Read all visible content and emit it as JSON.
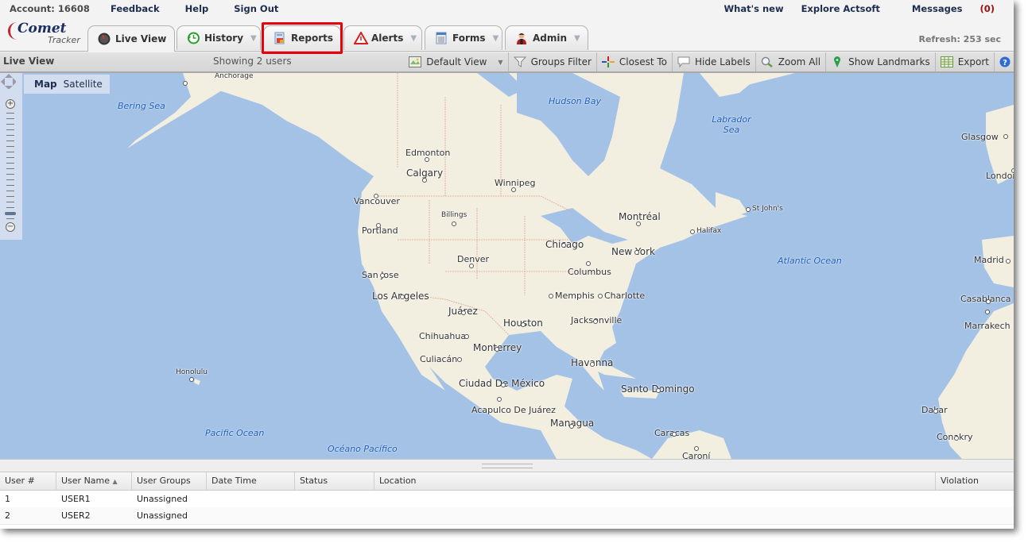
{
  "header": {
    "account_label": "Account: 16608",
    "links": [
      "Feedback",
      "Help",
      "Sign Out"
    ],
    "right_links": [
      "What's new",
      "Explore Actsoft"
    ],
    "messages_label": "Messages",
    "messages_count": "(0)",
    "refresh": "Refresh: 253 sec"
  },
  "logo": {
    "brand": "Comet",
    "sub": "Tracker"
  },
  "tabs": [
    {
      "label": "Live View",
      "icon": "speedometer-icon",
      "active": true,
      "dropdown": false
    },
    {
      "label": "History",
      "icon": "clock-icon",
      "active": false,
      "dropdown": true
    },
    {
      "label": "Reports",
      "icon": "report-icon",
      "active": false,
      "dropdown": false,
      "highlighted": true
    },
    {
      "label": "Alerts",
      "icon": "warning-icon",
      "active": false,
      "dropdown": true
    },
    {
      "label": "Forms",
      "icon": "document-icon",
      "active": false,
      "dropdown": true
    },
    {
      "label": "Admin",
      "icon": "user-icon",
      "active": false,
      "dropdown": true
    }
  ],
  "toolbar": {
    "title": "Live View",
    "showing": "Showing 2 users",
    "buttons": [
      {
        "label": "Default View",
        "icon": "map-view-icon",
        "dropdown": true
      },
      {
        "label": "Groups Filter",
        "icon": "funnel-icon"
      },
      {
        "label": "Closest To",
        "icon": "crosshair-icon"
      },
      {
        "label": "Hide Labels",
        "icon": "speech-bubble-icon"
      },
      {
        "label": "Zoom All",
        "icon": "magnifier-icon"
      },
      {
        "label": "Show Landmarks",
        "icon": "map-pin-icon"
      },
      {
        "label": "Export",
        "icon": "spreadsheet-icon"
      },
      {
        "label": "",
        "icon": "help-icon"
      }
    ]
  },
  "map": {
    "type_options": [
      "Map",
      "Satellite"
    ],
    "selected_type": "Map",
    "zoom_level_fraction": 0.12,
    "cities": [
      "Anchorage",
      "Edmonton",
      "Calgary",
      "Winnipeg",
      "Vancouver",
      "Billings",
      "Portland",
      "Montréal",
      "St John's",
      "Halifax",
      "Chicago",
      "New York",
      "Denver",
      "Columbus",
      "San Jose",
      "Los Angeles",
      "Memphis",
      "Charlotte",
      "Juárez",
      "Houston",
      "Jacksonville",
      "Chihuahua",
      "Monterrey",
      "Culiacán",
      "Havanna",
      "Ciudad De México",
      "Santo Domingo",
      "Acapulco De Juárez",
      "Managua",
      "Caracas",
      "Caroní",
      "Honolulu",
      "Glasgow",
      "London",
      "Madrid",
      "Casablanca",
      "Marrakech",
      "Dakar",
      "Conakry"
    ],
    "seas": [
      "Bering Sea",
      "Hudson Bay",
      "Labrador Sea",
      "Atlantic Ocean",
      "Pacific Ocean",
      "Océano Pacífico"
    ]
  },
  "grid": {
    "columns": [
      "User #",
      "User Name",
      "User Groups",
      "Date Time",
      "Status",
      "Location",
      "Violation"
    ],
    "sort_column": "User Name",
    "sort_dir": "asc",
    "rows": [
      [
        "1",
        "USER1",
        "Unassigned",
        "",
        "",
        "",
        ""
      ],
      [
        "2",
        "USER2",
        "Unassigned",
        "",
        "",
        "",
        ""
      ]
    ]
  }
}
